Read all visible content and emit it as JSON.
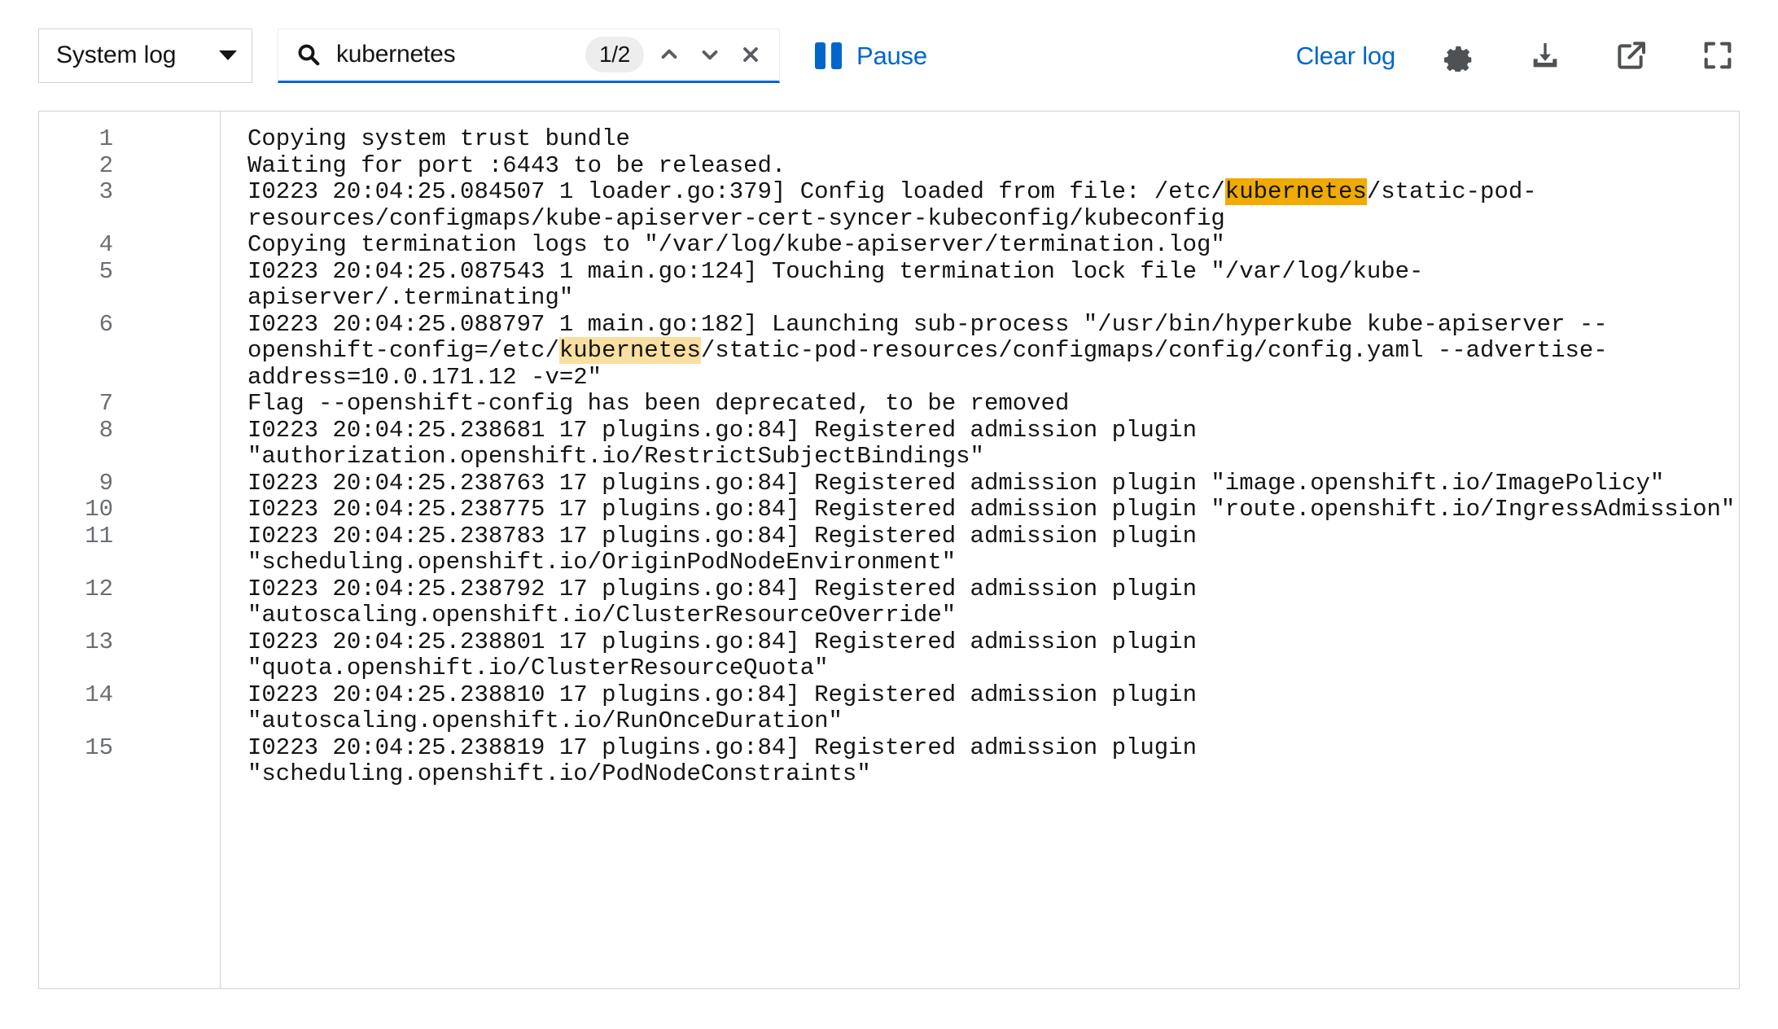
{
  "toolbar": {
    "log_select": {
      "name": "log-type-select",
      "value": "System log",
      "caret_icon": "chevron-down-icon"
    },
    "search": {
      "icon": "search-icon",
      "value": "kubernetes",
      "placeholder": "Search",
      "match_counter": "1/2",
      "prev_icon": "chevron-up-icon",
      "next_icon": "chevron-down-icon",
      "clear_icon": "close-icon"
    },
    "pause": {
      "label": "Pause",
      "icon": "pause-icon"
    },
    "clear_log_label": "Clear log",
    "actions": [
      {
        "name": "settings-button",
        "icon": "gear-icon"
      },
      {
        "name": "download-button",
        "icon": "download-icon"
      },
      {
        "name": "open-external-button",
        "icon": "external-link-icon"
      },
      {
        "name": "expand-button",
        "icon": "expand-icon"
      }
    ]
  },
  "colors": {
    "accent_blue": "#0066cc",
    "highlight_active": "#f0ab00",
    "highlight_inactive": "#f9e0a2",
    "border": "#d2d2d2",
    "line_number": "#6a6e73",
    "text": "#151515"
  },
  "log": {
    "line_numbers": [
      "1",
      "2",
      "3",
      "4",
      "5",
      "6",
      "7",
      "8",
      "9",
      "10",
      "11",
      "12",
      "13",
      "14",
      "15"
    ],
    "lines": [
      {
        "n": "1",
        "parts": [
          {
            "t": "Copying system trust bundle"
          }
        ]
      },
      {
        "n": "2",
        "parts": [
          {
            "t": "Waiting for port :6443 to be released."
          }
        ]
      },
      {
        "n": "3",
        "parts": [
          {
            "t": "I0223 20:04:25.084507 1 loader.go:379] Config loaded from file: /etc/"
          },
          {
            "t": "kubernetes",
            "hl": "active"
          },
          {
            "t": "/static-pod-resources/configmaps/kube-apiserver-cert-syncer-kubeconfig/kubeconfig"
          }
        ]
      },
      {
        "n": "4",
        "parts": [
          {
            "t": "Copying termination logs to \"/var/log/kube-apiserver/termination.log\""
          }
        ]
      },
      {
        "n": "5",
        "parts": [
          {
            "t": "I0223 20:04:25.087543 1 main.go:124] Touching termination lock file \"/var/log/kube-apiserver/.terminating\""
          }
        ]
      },
      {
        "n": "6",
        "parts": [
          {
            "t": "I0223 20:04:25.088797 1 main.go:182] Launching sub-process \"/usr/bin/hyperkube kube-apiserver --openshift-config=/etc/"
          },
          {
            "t": "kubernetes",
            "hl": "inactive"
          },
          {
            "t": "/static-pod-resources/configmaps/config/config.yaml --advertise-address=10.0.171.12 -v=2\""
          }
        ]
      },
      {
        "n": "7",
        "parts": [
          {
            "t": "Flag --openshift-config has been deprecated, to be removed"
          }
        ]
      },
      {
        "n": "8",
        "parts": [
          {
            "t": "I0223 20:04:25.238681 17 plugins.go:84] Registered admission plugin \"authorization.openshift.io/RestrictSubjectBindings\""
          }
        ]
      },
      {
        "n": "9",
        "parts": [
          {
            "t": "I0223 20:04:25.238763 17 plugins.go:84] Registered admission plugin \"image.openshift.io/ImagePolicy\""
          }
        ]
      },
      {
        "n": "10",
        "parts": [
          {
            "t": "I0223 20:04:25.238775 17 plugins.go:84] Registered admission plugin \"route.openshift.io/IngressAdmission\""
          }
        ]
      },
      {
        "n": "11",
        "parts": [
          {
            "t": "I0223 20:04:25.238783 17 plugins.go:84] Registered admission plugin \"scheduling.openshift.io/OriginPodNodeEnvironment\""
          }
        ]
      },
      {
        "n": "12",
        "parts": [
          {
            "t": "I0223 20:04:25.238792 17 plugins.go:84] Registered admission plugin \"autoscaling.openshift.io/ClusterResourceOverride\""
          }
        ]
      },
      {
        "n": "13",
        "parts": [
          {
            "t": "I0223 20:04:25.238801 17 plugins.go:84] Registered admission plugin \"quota.openshift.io/ClusterResourceQuota\""
          }
        ]
      },
      {
        "n": "14",
        "parts": [
          {
            "t": "I0223 20:04:25.238810 17 plugins.go:84] Registered admission plugin \"autoscaling.openshift.io/RunOnceDuration\""
          }
        ]
      },
      {
        "n": "15",
        "parts": [
          {
            "t": "I0223 20:04:25.238819 17 plugins.go:84] Registered admission plugin \"scheduling.openshift.io/PodNodeConstraints\""
          }
        ]
      }
    ]
  }
}
